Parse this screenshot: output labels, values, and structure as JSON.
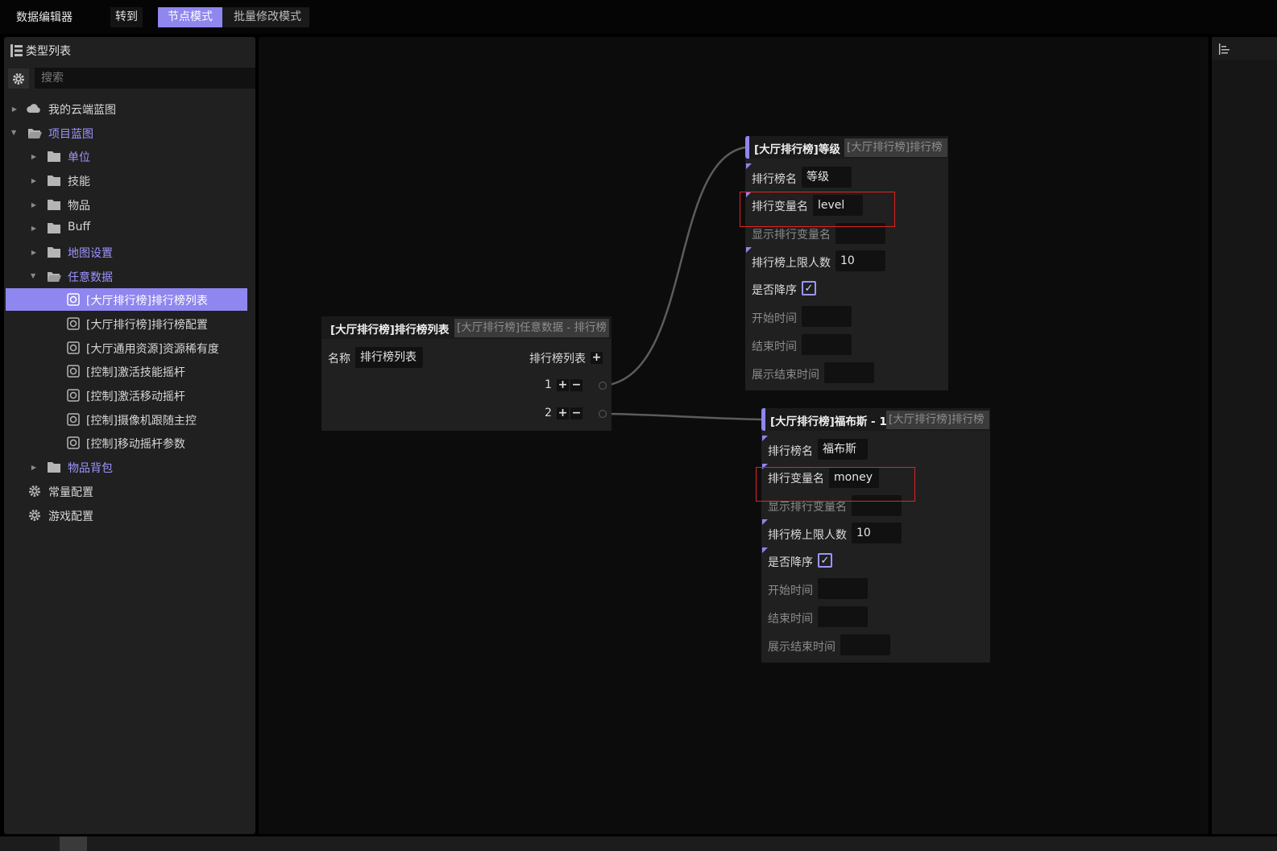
{
  "topbar": {
    "title": "数据编辑器",
    "goto_label": "转到",
    "modes": [
      "节点模式",
      "批量修改模式"
    ]
  },
  "left_panel": {
    "header": "类型列表",
    "search_placeholder": "搜索",
    "tree": [
      {
        "label": "我的云端蓝图",
        "icon": "cloud-icon"
      },
      {
        "label": "项目蓝图",
        "icon": "folder-open-icon"
      },
      {
        "label": "单位",
        "icon": "folder-icon"
      },
      {
        "label": "技能",
        "icon": "folder-icon"
      },
      {
        "label": "物品",
        "icon": "folder-icon"
      },
      {
        "label": "Buff",
        "icon": "folder-icon"
      },
      {
        "label": "地图设置",
        "icon": "folder-icon"
      },
      {
        "label": "任意数据",
        "icon": "folder-open-icon"
      },
      {
        "label": "[大厅排行榜]排行榜列表",
        "icon": "data-icon"
      },
      {
        "label": "[大厅排行榜]排行榜配置",
        "icon": "data-icon"
      },
      {
        "label": "[大厅通用资源]资源稀有度",
        "icon": "data-icon"
      },
      {
        "label": "[控制]激活技能摇杆",
        "icon": "data-icon"
      },
      {
        "label": "[控制]激活移动摇杆",
        "icon": "data-icon"
      },
      {
        "label": "[控制]摄像机跟随主控",
        "icon": "data-icon"
      },
      {
        "label": "[控制]移动摇杆参数",
        "icon": "data-icon"
      },
      {
        "label": "物品背包",
        "icon": "folder-icon"
      },
      {
        "label": "常量配置",
        "icon": "gear-icon"
      },
      {
        "label": "游戏配置",
        "icon": "gear-icon"
      }
    ]
  },
  "list_node": {
    "title": "[大厅排行榜]排行榜列表",
    "type": "[大厅排行榜]任意数据 - 排行榜",
    "name_label": "名称",
    "name_value": "排行榜列表",
    "list_label": "排行榜列表",
    "rows": [
      "1",
      "2"
    ]
  },
  "level_node": {
    "title": "[大厅排行榜]等级",
    "type": "[大厅排行榜]排行榜",
    "fields": {
      "name_label": "排行榜名",
      "name_value": "等级",
      "var_label": "排行变量名",
      "var_value": "level",
      "show_var_label": "显示排行变量名",
      "show_var_value": "",
      "limit_label": "排行榜上限人数",
      "limit_value": "10",
      "desc_label": "是否降序",
      "desc_checked": true,
      "start_label": "开始时间",
      "start_value": "",
      "end_label": "结束时间",
      "end_value": "",
      "show_end_label": "展示结束时间",
      "show_end_value": ""
    }
  },
  "money_node": {
    "title": "[大厅排行榜]福布斯 - 1",
    "type": "[大厅排行榜]排行榜",
    "fields": {
      "name_label": "排行榜名",
      "name_value": "福布斯",
      "var_label": "排行变量名",
      "var_value": "money",
      "show_var_label": "显示排行变量名",
      "show_var_value": "",
      "limit_label": "排行榜上限人数",
      "limit_value": "10",
      "desc_label": "是否降序",
      "desc_checked": true,
      "start_label": "开始时间",
      "start_value": "",
      "end_label": "结束时间",
      "end_value": "",
      "show_end_label": "展示结束时间",
      "show_end_value": ""
    }
  },
  "colors": {
    "accent": "#8f86f0",
    "highlight_box": "#e02424",
    "canvas_bg": "#0c0c0c",
    "panel_bg": "#202020"
  },
  "checkmark": "✓",
  "plus": "+",
  "minus": "−"
}
